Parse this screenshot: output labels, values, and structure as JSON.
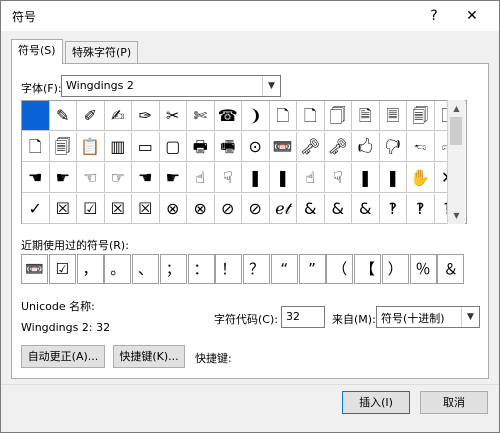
{
  "window": {
    "title": "符号",
    "help_label": "?",
    "close_label": "✕"
  },
  "tabs": [
    {
      "label": "符号(S)"
    },
    {
      "label": "特殊字符(P)"
    }
  ],
  "font": {
    "label": "字体(F):",
    "value": "Wingdings 2",
    "arrow": "▼"
  },
  "grid": {
    "rows": [
      [
        "",
        "✎",
        "✐",
        "✍",
        "✑",
        "✂",
        "✄",
        "☎",
        "❩",
        "🗋",
        "🗋",
        "🗍",
        "🗎",
        "🗏",
        "🗐",
        "🗋"
      ],
      [
        "🗋",
        "🗐",
        "📋",
        "▥",
        "▭",
        "▢",
        "🖶",
        "🖷",
        "⊙",
        "📼",
        "🗝",
        "🗝",
        "🖒",
        "🖓",
        "🖘",
        "🖙"
      ],
      [
        "☚",
        "☛",
        "☜",
        "☞",
        "☚",
        "☛",
        "☝",
        "☟",
        "❚",
        "❚",
        "☝",
        "☟",
        "❚",
        "❚",
        "✋",
        "✕"
      ],
      [
        "✓",
        "☒",
        "☑",
        "☒",
        "☒",
        "⊗",
        "⊗",
        "⊘",
        "⊘",
        "ℯ𝓉",
        "&",
        "&",
        "&",
        "‽",
        "‽",
        "‽"
      ]
    ],
    "scroll_up": "▲",
    "scroll_down": "▼"
  },
  "recent": {
    "label": "近期使用过的符号(R):",
    "symbols": [
      "📼",
      "☑",
      "，",
      "。",
      "、",
      "；",
      "：",
      "！",
      "？",
      "“",
      "”",
      "（",
      "【",
      "）",
      "％",
      "＆"
    ]
  },
  "info": {
    "unicode_label": "Unicode 名称:",
    "name_value": "Wingdings 2: 32",
    "char_code_label": "字符代码(C):",
    "char_code_value": "32",
    "from_label": "来自(M):",
    "from_value": "符号(十进制)"
  },
  "buttons": {
    "autocorrect": "自动更正(A)...",
    "shortcut_key": "快捷键(K)...",
    "shortcut_label": "快捷键:",
    "insert": "插入(I)",
    "cancel": "取消"
  }
}
